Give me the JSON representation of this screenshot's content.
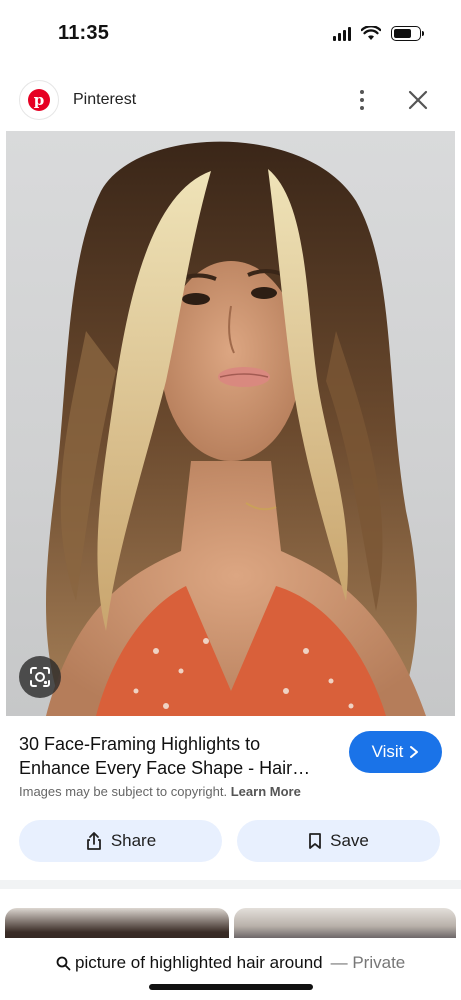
{
  "status_bar": {
    "time": "11:35",
    "icons": [
      "cellular-signal-icon",
      "wifi-icon",
      "battery-icon"
    ]
  },
  "header": {
    "site_name": "Pinterest",
    "logo_letter": "p",
    "icons": [
      "pinterest-logo-icon",
      "more-options-icon",
      "close-icon"
    ]
  },
  "result": {
    "title_line1": "30 Face-Framing Highlights to",
    "title_line2": "Enhance Every Face Shape - Hair…",
    "visit_label": "Visit",
    "copyright_text": "Images may be subject to copyright.",
    "learn_more_label": "Learn More"
  },
  "actions": {
    "share_label": "Share",
    "save_label": "Save"
  },
  "search": {
    "query": "picture of highlighted hair around",
    "privacy_label": "— Private"
  },
  "colors": {
    "accent": "#1a73e8",
    "brand": "#e60023",
    "button_bg": "#e8f0fe"
  }
}
